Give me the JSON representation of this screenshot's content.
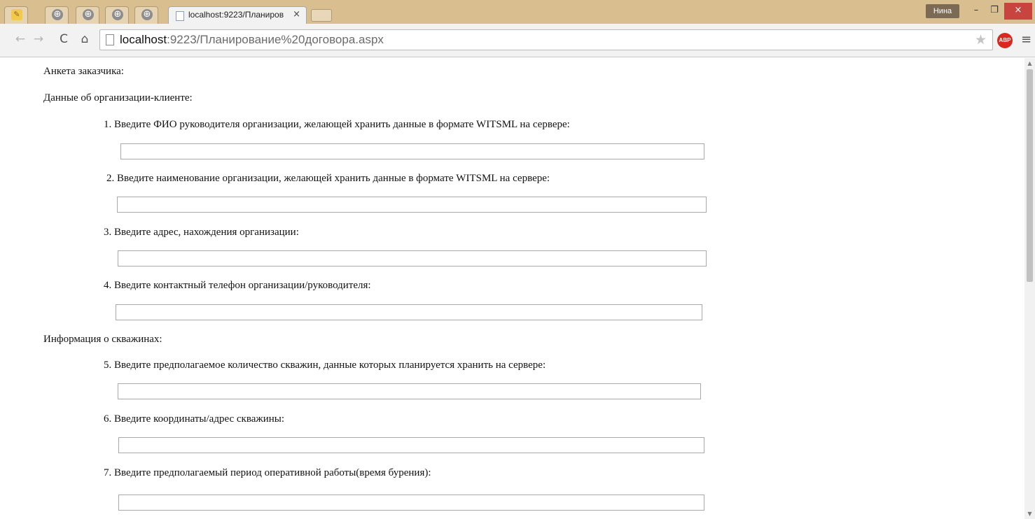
{
  "browser": {
    "tab_title": "localhost:9223/Планиров",
    "tab_close": "×",
    "user_name": "Нина",
    "window_controls": {
      "minimize": "–",
      "maximize": "❐",
      "close": "×"
    },
    "url_host": "localhost",
    "url_rest": ":9223/Планирование%20договора.aspx",
    "adblock_label": "ABP",
    "icons": {
      "back": "←",
      "forward": "→",
      "reload": "C",
      "home": "⌂",
      "star": "★",
      "menu": "≡",
      "pinned": "⊕",
      "scroll_up": "▲",
      "scroll_down": "▼"
    }
  },
  "form": {
    "title": "Анкета заказчика:",
    "section1_title": "Данные об организации-клиенте:",
    "section2_title": "Информация о скважинах:",
    "questions": [
      {
        "label": "1. Введите ФИО руководителя организации, желающей хранить данные в формате WITSML на сервере:",
        "value": ""
      },
      {
        "label": "2. Введите наименование организации, желающей хранить данные в формате WITSML на сервере:",
        "value": ""
      },
      {
        "label": "3. Введите адрес, нахождения организации:",
        "value": ""
      },
      {
        "label": "4. Введите контактный телефон организации/руководителя:",
        "value": ""
      },
      {
        "label": "5. Введите предполагаемое количество скважин, данные которых планируется хранить на сервере:",
        "value": ""
      },
      {
        "label": "6. Введите координаты/адрес скважины:",
        "value": ""
      },
      {
        "label": "7. Введите предполагаемый период оперативной работы(время бурения):",
        "value": ""
      }
    ]
  }
}
